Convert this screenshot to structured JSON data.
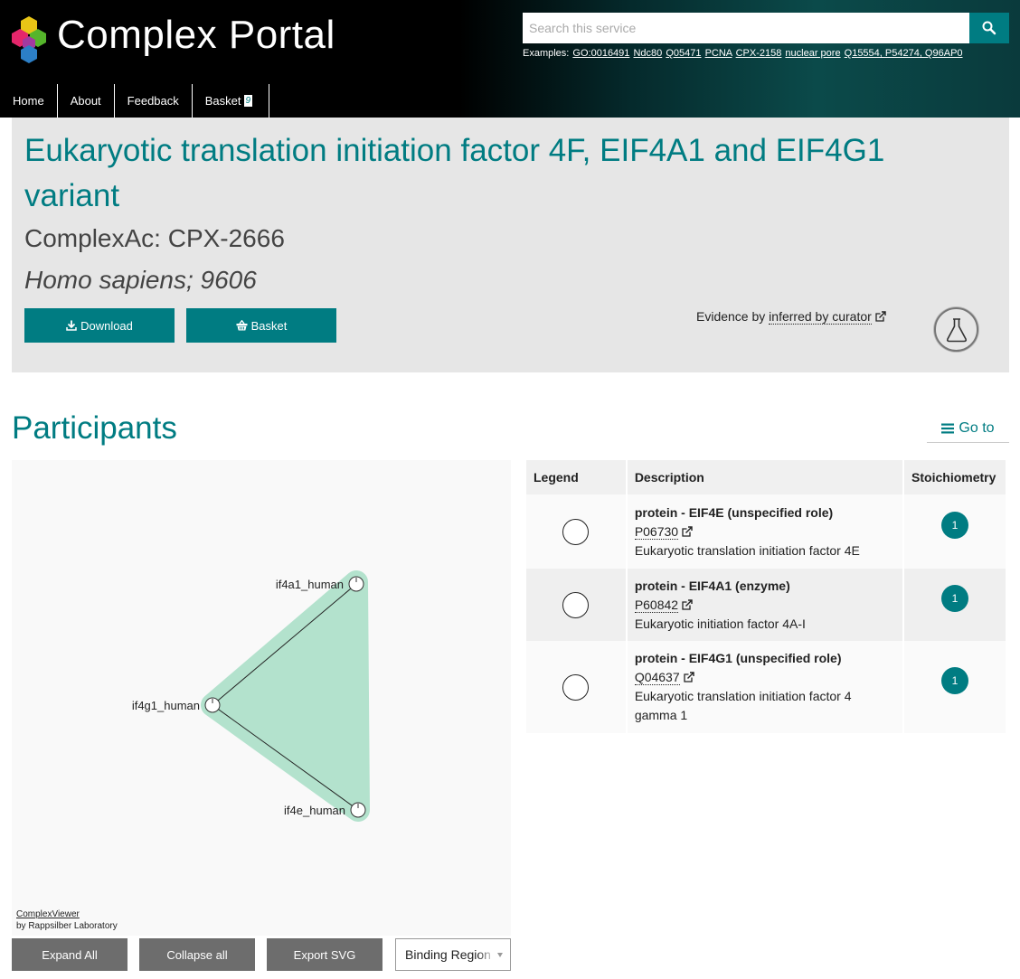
{
  "header": {
    "brand": "Complex Portal",
    "search_placeholder": "Search this service",
    "examples_label": "Examples:",
    "examples": [
      "GO:0016491",
      "Ndc80",
      "Q05471",
      "PCNA",
      "CPX-2158",
      "nuclear pore",
      "Q15554, P54274, Q96AP0"
    ],
    "logo_colors": [
      "#e8c516",
      "#e5266b",
      "#55b52b",
      "#a23aa0",
      "#2c7fc7",
      "#e08b1a"
    ],
    "nav": [
      {
        "label": "Home"
      },
      {
        "label": "About"
      },
      {
        "label": "Feedback"
      },
      {
        "label": "Basket",
        "count": "9"
      }
    ]
  },
  "complex": {
    "title": "Eukaryotic translation initiation factor 4F, EIF4A1 and EIF4G1 variant",
    "ac": "ComplexAc: CPX-2666",
    "organism": "Homo sapiens; 9606",
    "download_label": "Download",
    "basket_label": "Basket",
    "evidence_prefix": "Evidence by",
    "evidence_link": "inferred by curator"
  },
  "participants": {
    "heading": "Participants",
    "goto_label": "Go to",
    "viewer": {
      "nodes": [
        {
          "id": "if4a1",
          "label": "if4a1_human"
        },
        {
          "id": "if4g1",
          "label": "if4g1_human"
        },
        {
          "id": "if4e",
          "label": "if4e_human"
        }
      ],
      "credit_link": "ComplexViewer",
      "credit_text": "by Rappsilber Laboratory",
      "complex_color": "#b3e2cd"
    },
    "buttons": {
      "expand": "Expand All",
      "collapse": "Collapse all",
      "export": "Export SVG",
      "binding": "Binding Region"
    },
    "table": {
      "headers": [
        "Legend",
        "Description",
        "Stoichiometry"
      ],
      "rows": [
        {
          "title": "protein - EIF4E (unspecified role)",
          "id": "P06730",
          "name": "Eukaryotic translation initiation factor 4E",
          "stoich": "1"
        },
        {
          "title": "protein - EIF4A1 (enzyme)",
          "id": "P60842",
          "name": "Eukaryotic initiation factor 4A-I",
          "stoich": "1"
        },
        {
          "title": "protein - EIF4G1 (unspecified role)",
          "id": "Q04637",
          "name": "Eukaryotic translation initiation factor 4 gamma 1",
          "stoich": "1"
        }
      ]
    }
  }
}
